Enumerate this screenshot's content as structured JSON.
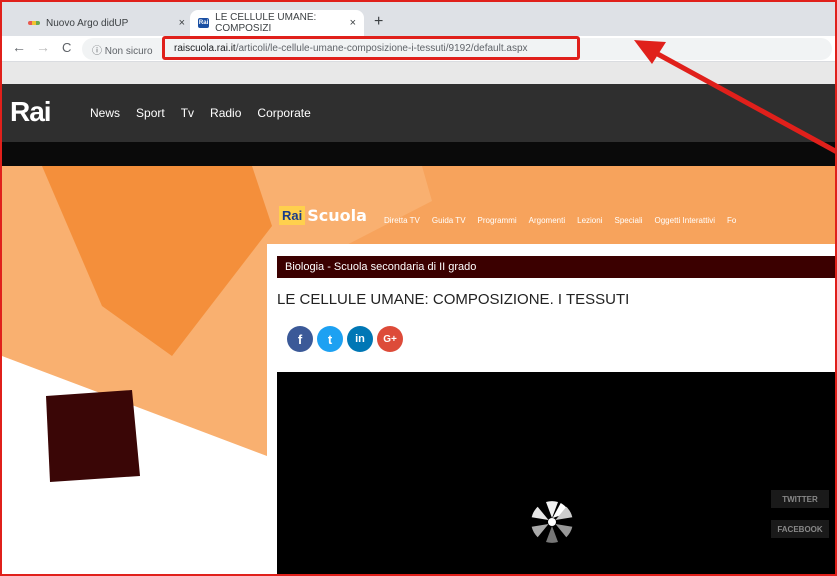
{
  "browser": {
    "tabs": [
      {
        "title": "Nuovo Argo didUP",
        "close": "×"
      },
      {
        "title": "LE CELLULE UMANE: COMPOSIZI",
        "close": "×",
        "favicon_text": "Rai"
      }
    ],
    "new_tab": "+",
    "nav": {
      "back": "←",
      "forward": "→",
      "reload": "C"
    },
    "security_label": "ⓘ Non sicuro",
    "url_domain": "raiscuola.rai.it",
    "url_path": "/articoli/le-cellule-umane-composizione-i-tessuti/9192/default.aspx"
  },
  "rai_header": {
    "logo": "Rai",
    "nav": [
      "News",
      "Sport",
      "Tv",
      "Radio",
      "Corporate"
    ]
  },
  "raiscuola": {
    "logo_rai": "Rai",
    "logo_scuola": "Scuola",
    "nav": [
      "Diretta TV",
      "Guida TV",
      "Programmi",
      "Argomenti",
      "Lezioni",
      "Speciali",
      "Oggetti Interattivi",
      "Fo"
    ]
  },
  "article": {
    "breadcrumb": "Biologia - Scuola secondaria di II grado",
    "title": "LE CELLULE UMANE: COMPOSIZIONE. I TESSUTI",
    "social": [
      {
        "icon": "facebook-icon",
        "glyph": "f",
        "color": "#3b5998"
      },
      {
        "icon": "twitter-icon",
        "glyph": "t",
        "color": "#1da1f2"
      },
      {
        "icon": "linkedin-icon",
        "glyph": "in",
        "color": "#0077b5"
      },
      {
        "icon": "google-plus-icon",
        "glyph": "G+",
        "color": "#dd4b39"
      }
    ],
    "video_buttons": {
      "twitter": "TWITTER",
      "facebook": "FACEBOOK"
    }
  },
  "colors": {
    "annotation_red": "#e0201b",
    "page_orange": "#f7a35c",
    "breadcrumb_bg": "#3b0000"
  }
}
